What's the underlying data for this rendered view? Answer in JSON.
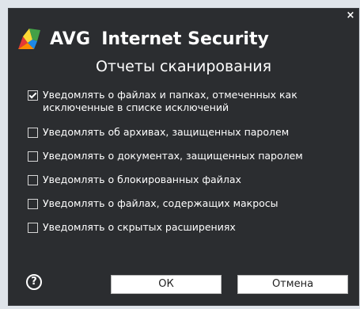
{
  "window": {
    "close_glyph": "×"
  },
  "header": {
    "brand": "AVG",
    "product": "Internet Security",
    "logo_icon": "avg-logo-icon"
  },
  "title": "Отчеты сканирования",
  "options": [
    {
      "label": "Уведомлять о файлах и папках, отмеченных как исключенные в списке исключений",
      "checked": true
    },
    {
      "label": "Уведомлять об архивах, защищенных паролем",
      "checked": false
    },
    {
      "label": "Уведомлять о документах, защищенных паролем",
      "checked": false
    },
    {
      "label": "Уведомлять о блокированных файлах",
      "checked": false
    },
    {
      "label": "Уведомлять о файлах, содержащих макросы",
      "checked": false
    },
    {
      "label": "Уведомлять о скрытых расширениях",
      "checked": false
    }
  ],
  "footer": {
    "help_glyph": "?",
    "ok_label": "ОК",
    "cancel_label": "Отмена"
  },
  "colors": {
    "dialog_bg": "#2b2d30",
    "text": "#ffffff",
    "button_bg": "#ffffff"
  }
}
